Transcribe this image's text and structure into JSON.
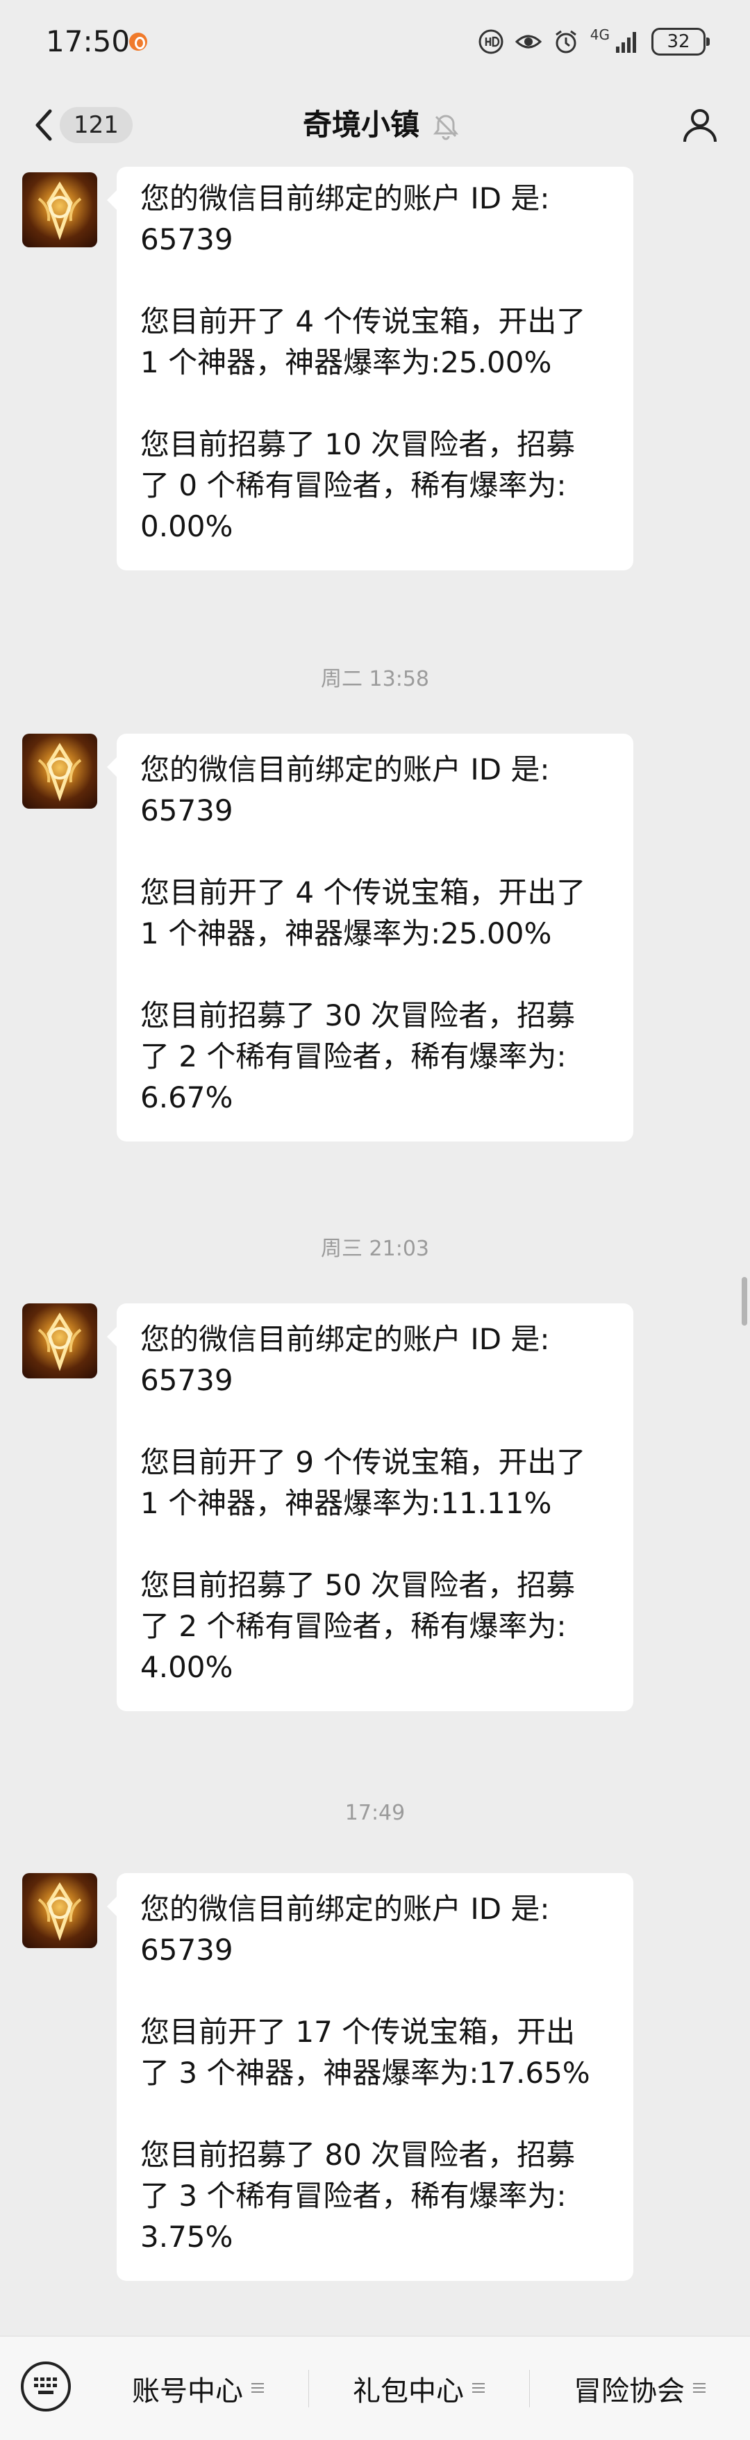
{
  "status_bar": {
    "time": "17:50",
    "network": "4G",
    "battery": "32"
  },
  "header": {
    "unread_count": "121",
    "title": "奇境小镇"
  },
  "messages": [
    {
      "timestamp": "",
      "paragraphs": [
        "您的微信目前绑定的账户 ID 是:\n65739",
        "您目前开了 4 个传说宝箱，开出了\n1 个神器，神器爆率为:25.00%",
        "您目前招募了 10 次冒险者，招募\n了 0 个稀有冒险者，稀有爆率为:\n0.00%"
      ]
    },
    {
      "timestamp": "周二 13:58",
      "paragraphs": [
        "您的微信目前绑定的账户 ID 是:\n65739",
        "您目前开了 4 个传说宝箱，开出了\n1 个神器，神器爆率为:25.00%",
        "您目前招募了 30 次冒险者，招募\n了 2 个稀有冒险者，稀有爆率为:\n6.67%"
      ]
    },
    {
      "timestamp": "周三 21:03",
      "paragraphs": [
        "您的微信目前绑定的账户 ID 是:\n65739",
        "您目前开了 9 个传说宝箱，开出了\n1 个神器，神器爆率为:11.11%",
        "您目前招募了 50 次冒险者，招募\n了 2 个稀有冒险者，稀有爆率为:\n4.00%"
      ]
    },
    {
      "timestamp": "17:49",
      "paragraphs": [
        "您的微信目前绑定的账户 ID 是:\n65739",
        "您目前开了 17 个传说宝箱，开出\n了 3 个神器，神器爆率为:17.65%",
        "您目前招募了 80 次冒险者，招募\n了 3 个稀有冒险者，稀有爆率为:\n3.75%"
      ]
    }
  ],
  "bottom_menu": {
    "items": [
      {
        "label": "账号中心"
      },
      {
        "label": "礼包中心"
      },
      {
        "label": "冒险协会"
      }
    ]
  },
  "icons": {
    "back": "chevron-left-icon",
    "mute": "bell-off-icon",
    "profile": "person-icon",
    "keyboard": "keyboard-icon"
  },
  "colors": {
    "background": "#ededed",
    "bubble": "#ffffff",
    "timestamp": "#9b9b9b",
    "app_dot": "#f07a2b"
  }
}
